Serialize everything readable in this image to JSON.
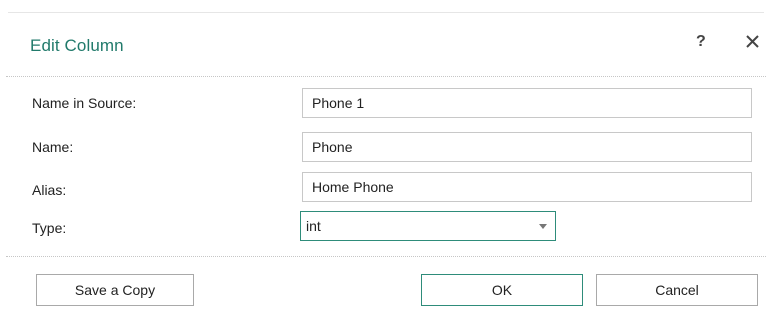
{
  "dialog": {
    "title": "Edit Column",
    "help_label": "?",
    "close_icon": "close-icon"
  },
  "form": {
    "name_in_source": {
      "label": "Name in Source:",
      "value": "Phone 1"
    },
    "name": {
      "label": "Name:",
      "value": "Phone"
    },
    "alias": {
      "label": "Alias:",
      "value": "Home Phone"
    },
    "type": {
      "label": "Type:",
      "value": "int"
    }
  },
  "buttons": {
    "save_copy": "Save a Copy",
    "ok": "OK",
    "cancel": "Cancel"
  },
  "colors": {
    "accent": "#217a6b",
    "focus_border": "#2e8c7a"
  }
}
